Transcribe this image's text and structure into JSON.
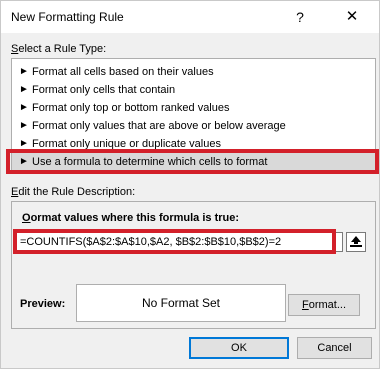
{
  "window": {
    "title": "New Formatting Rule",
    "help_label": "?",
    "close_label": "✕"
  },
  "rule_type": {
    "section_label": "Select a Rule Type:",
    "items": [
      {
        "label": "Format all cells based on their values"
      },
      {
        "label": "Format only cells that contain"
      },
      {
        "label": "Format only top or bottom ranked values"
      },
      {
        "label": "Format only values that are above or below average"
      },
      {
        "label": "Format only unique or duplicate values"
      },
      {
        "label": "Use a formula to determine which cells to format"
      }
    ],
    "selected_index": 5
  },
  "description": {
    "section_label": "Edit the Rule Description:",
    "formula_label": "Format values where this formula is true:",
    "formula_value": "=COUNTIFS($A$2:$A$10,$A2, $B$2:$B$10,$B$2)=2",
    "preview_label": "Preview:",
    "preview_text": "No Format Set",
    "format_button": "Format..."
  },
  "footer": {
    "ok_label": "OK",
    "cancel_label": "Cancel"
  },
  "colors": {
    "highlight": "#d3202a",
    "selected_row": "#d9d9d9",
    "default_button_border": "#0078d7"
  },
  "icons": {
    "rule_arrow": "arrow-right-icon",
    "collapse": "collapse-dialog-icon"
  }
}
